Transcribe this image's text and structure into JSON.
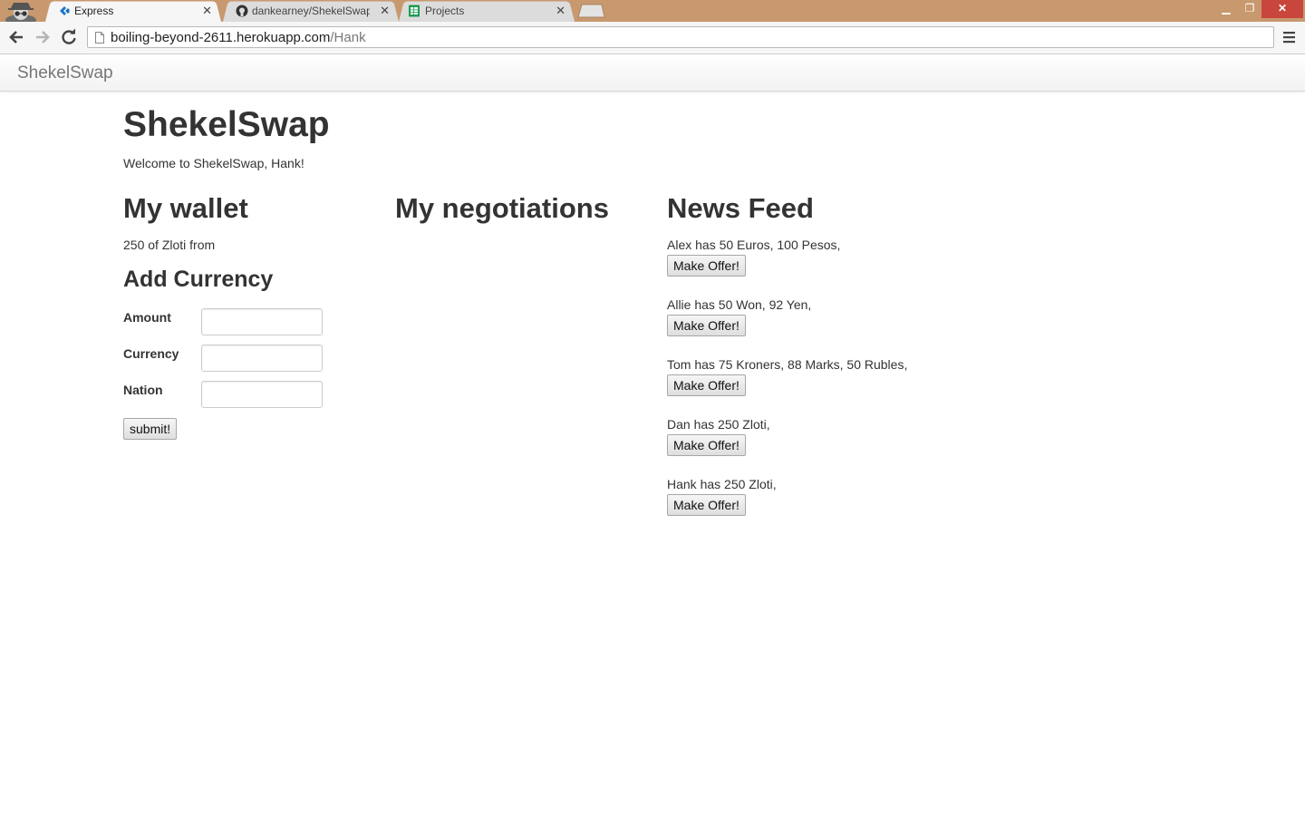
{
  "browser": {
    "tabs": [
      {
        "title": "Express",
        "active": true
      },
      {
        "title": "dankearney/ShekelSwap ·",
        "active": false
      },
      {
        "title": "Projects",
        "active": false
      }
    ],
    "url_host": "boiling-beyond-2611.herokuapp.com",
    "url_path": "/Hank",
    "colors": {
      "frame": "#c8996e",
      "close": "#c9463d"
    }
  },
  "navbar": {
    "brand": "ShekelSwap"
  },
  "page": {
    "title": "ShekelSwap",
    "welcome": "Welcome to ShekelSwap, Hank!"
  },
  "wallet": {
    "heading": "My wallet",
    "line": "250 of Zloti from",
    "add_heading": "Add Currency",
    "fields": [
      {
        "label": "Amount",
        "value": ""
      },
      {
        "label": "Currency",
        "value": ""
      },
      {
        "label": "Nation",
        "value": ""
      }
    ],
    "submit_label": "submit!"
  },
  "negotiations": {
    "heading": "My negotiations"
  },
  "feed": {
    "heading": "News Feed",
    "button_label": "Make Offer!",
    "items": [
      {
        "text": "Alex has 50 Euros, 100 Pesos,"
      },
      {
        "text": "Allie has 50 Won, 92 Yen,"
      },
      {
        "text": "Tom has 75 Kroners, 88 Marks, 50 Rubles,"
      },
      {
        "text": "Dan has 250 Zloti,"
      },
      {
        "text": "Hank has 250 Zloti,"
      }
    ]
  }
}
